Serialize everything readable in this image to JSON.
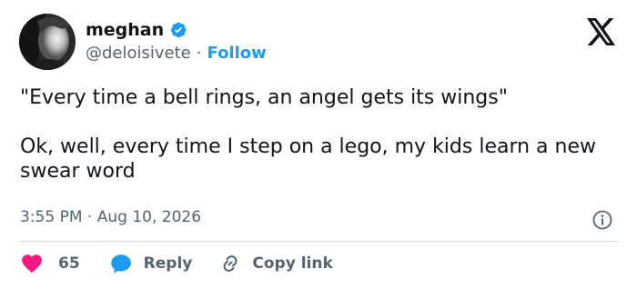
{
  "author": {
    "name": "meghan",
    "handle": "@deloisivete",
    "separator": "·",
    "follow_label": "Follow"
  },
  "tweet": {
    "line1": "\"Every time a bell rings, an angel gets its wings\"",
    "line2": "Ok, well, every time I step on a lego, my kids learn a new swear word"
  },
  "meta": {
    "time": "3:55 PM",
    "separator": "·",
    "date": "Aug 10, 2026"
  },
  "actions": {
    "like_count": "65",
    "reply_label": "Reply",
    "copy_label": "Copy link"
  },
  "icons": {
    "verified": "verified-badge-icon",
    "platform": "x-logo-icon",
    "info": "info-icon",
    "like": "heart-icon",
    "reply": "speech-bubble-icon",
    "copy": "link-icon"
  },
  "colors": {
    "accent": "#1d9bf0",
    "like": "#f91880",
    "text": "#0f1419",
    "secondary": "#536471"
  }
}
